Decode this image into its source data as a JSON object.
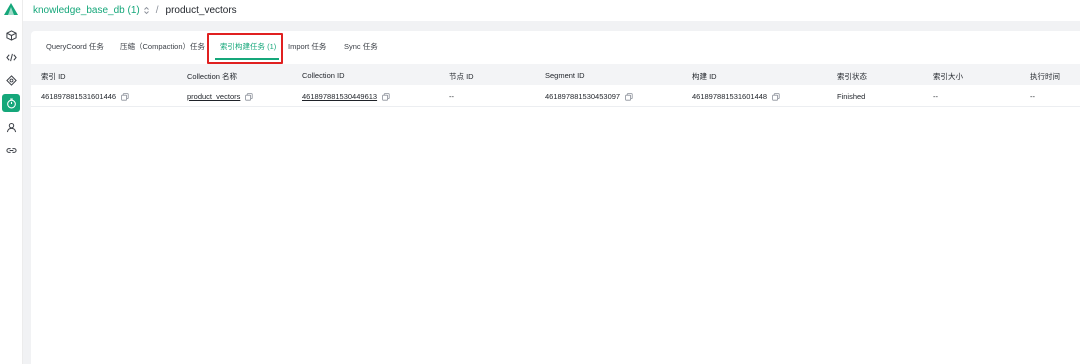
{
  "breadcrumb": {
    "database": "knowledge_base_db (1)",
    "separator": "/",
    "collection": "product_vectors"
  },
  "sidebar": {
    "items": [
      {
        "icon": "cube-icon"
      },
      {
        "icon": "code-icon"
      },
      {
        "icon": "diamond-nodes-icon"
      },
      {
        "icon": "timer-icon",
        "active": true
      },
      {
        "icon": "user-icon"
      },
      {
        "icon": "link-icon"
      }
    ]
  },
  "tabs": [
    {
      "label": "QueryCoord 任务"
    },
    {
      "label": "压缩（Compaction）任务"
    },
    {
      "label": "索引构建任务 (1)",
      "active": true
    },
    {
      "label": "Import 任务"
    },
    {
      "label": "Sync 任务"
    }
  ],
  "table": {
    "headers": [
      "索引 ID",
      "Collection 名称",
      "Collection ID",
      "节点 ID",
      "Segment ID",
      "构建 ID",
      "索引状态",
      "索引大小",
      "执行时间"
    ],
    "rows": [
      {
        "index_id": "461897881531601446",
        "collection_name": "product_vectors",
        "collection_id": "461897881530449613",
        "node_id": "--",
        "segment_id": "461897881530453097",
        "build_id": "461897881531601448",
        "status": "Finished",
        "size": "--",
        "exec_time": "--"
      }
    ]
  },
  "colors": {
    "accent": "#15a77a",
    "highlight": "#e02020"
  }
}
